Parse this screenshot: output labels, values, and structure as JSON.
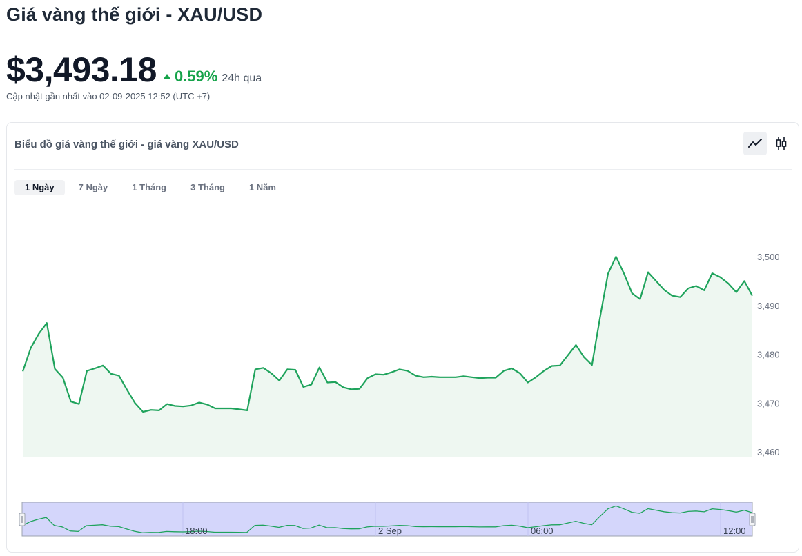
{
  "header": {
    "title": "Giá vàng thế giới - XAU/USD",
    "price": "$3,493.18",
    "change_pct": "0.59%",
    "change_period": "24h qua",
    "updated": "Cập nhật gần nhất vào 02-09-2025 12:52 (UTC +7)"
  },
  "card": {
    "title": "Biểu đồ giá vàng thế giới - giá vàng XAU/USD",
    "view_modes": [
      "line-chart-icon",
      "candlestick-icon"
    ],
    "tabs": [
      {
        "label": "1 Ngày",
        "active": true
      },
      {
        "label": "7 Ngày",
        "active": false
      },
      {
        "label": "1 Tháng",
        "active": false
      },
      {
        "label": "3 Tháng",
        "active": false
      },
      {
        "label": "1 Năm",
        "active": false
      }
    ]
  },
  "colors": {
    "line": "#1fa35c",
    "area": "#eef7f1",
    "up": "#16a34a",
    "navigator_fill": "#d4d6fb",
    "navigator_border": "#9ca3af"
  },
  "chart_data": {
    "type": "area",
    "x_range": [
      "2025-09-01 12:52",
      "2025-09-02 12:52"
    ],
    "ylim": [
      3460,
      3500
    ],
    "y_ticks": [
      3500,
      3490,
      3480,
      3470,
      3460
    ],
    "y_tick_labels": [
      "3,500",
      "3,490",
      "3,480",
      "3,470",
      "3,460"
    ],
    "series": [
      {
        "values": [
          3476.5,
          3481.3,
          3484.2,
          3486.4,
          3477.0,
          3475.2,
          3470.3,
          3469.8,
          3476.6,
          3477.1,
          3477.7,
          3476.0,
          3475.6,
          3472.7,
          3470.0,
          3468.2,
          3468.6,
          3468.5,
          3469.8,
          3469.4,
          3469.3,
          3469.5,
          3470.1,
          3469.7,
          3468.9,
          3468.9,
          3468.9,
          3468.7,
          3468.5,
          3476.9,
          3477.2,
          3476.1,
          3474.6,
          3476.9,
          3476.8,
          3473.3,
          3473.8,
          3477.3,
          3474.2,
          3474.3,
          3473.2,
          3472.8,
          3472.9,
          3475.1,
          3475.9,
          3475.8,
          3476.3,
          3476.9,
          3476.6,
          3475.6,
          3475.3,
          3475.4,
          3475.3,
          3475.3,
          3475.3,
          3475.5,
          3475.3,
          3475.1,
          3475.2,
          3475.2,
          3476.6,
          3477.1,
          3476.1,
          3474.2,
          3475.3,
          3476.6,
          3477.6,
          3477.7,
          3479.8,
          3481.9,
          3479.4,
          3477.8,
          3487.5,
          3496.5,
          3500.0,
          3496.5,
          3492.5,
          3491.3,
          3496.8,
          3495.0,
          3493.2,
          3492.0,
          3491.7,
          3493.5,
          3494.0,
          3493.1,
          3496.6,
          3495.8,
          3494.5,
          3492.7,
          3495.0,
          3492.0
        ]
      }
    ],
    "navigator": {
      "x_labels": [
        "18:00",
        "2 Sep",
        "06:00",
        "12:00"
      ]
    }
  }
}
